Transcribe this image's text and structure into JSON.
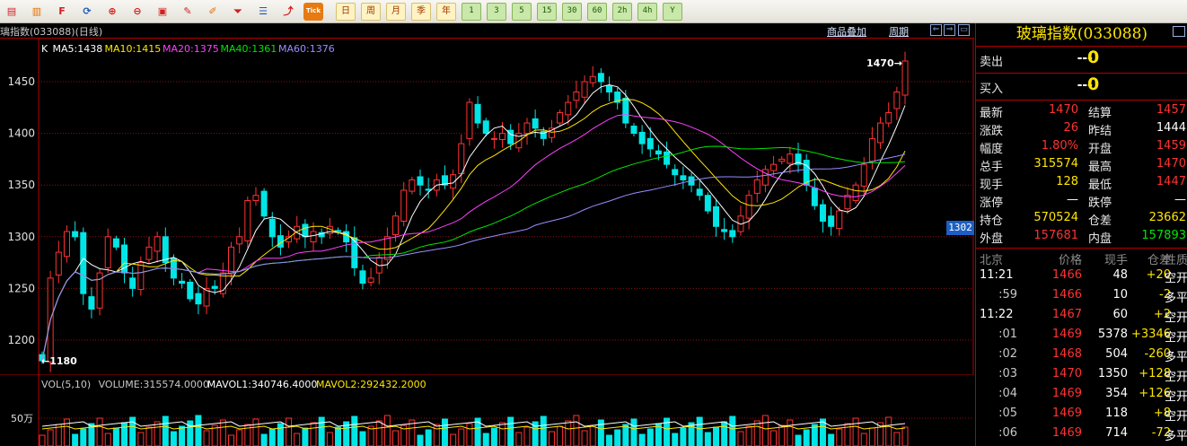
{
  "toolbar": {
    "buttons": [
      {
        "name": "menu-icon",
        "glyph": "▤"
      },
      {
        "name": "save-icon",
        "glyph": "▥"
      },
      {
        "name": "f10-icon",
        "glyph": "F"
      },
      {
        "name": "refresh-icon",
        "glyph": "⟳"
      },
      {
        "name": "zoom-in-icon",
        "glyph": "⊕"
      },
      {
        "name": "zoom-out-icon",
        "glyph": "⊖"
      },
      {
        "name": "window-icon",
        "glyph": "▣"
      },
      {
        "name": "pencil-icon",
        "glyph": "✎"
      },
      {
        "name": "brush-icon",
        "glyph": "✐"
      },
      {
        "name": "filter-icon",
        "glyph": "⏷"
      },
      {
        "name": "list-icon",
        "glyph": "☰"
      },
      {
        "name": "trend-icon",
        "glyph": "⤴"
      },
      {
        "name": "tick-icon",
        "glyph": "Tick"
      }
    ],
    "periods": [
      "日",
      "周",
      "月",
      "季",
      "年"
    ],
    "active_period": "日",
    "minute_buttons": [
      "1",
      "3",
      "5",
      "15",
      "30",
      "60",
      "2h",
      "4h",
      "Y"
    ]
  },
  "chart": {
    "title": "璃指数(033088)(日线)",
    "overlay_label": "商品叠加",
    "period_label": "周期",
    "ma_legend": [
      {
        "label": "K",
        "color": "#ffffff"
      },
      {
        "label": "MA5:1438",
        "color": "#ffffff"
      },
      {
        "label": "MA10:1415",
        "color": "#ffe600"
      },
      {
        "label": "MA20:1375",
        "color": "#ff40ff"
      },
      {
        "label": "MA40:1361",
        "color": "#00e600"
      },
      {
        "label": "MA60:1376",
        "color": "#9a8cff"
      }
    ],
    "y_ticks": [
      "1450",
      "1400",
      "1350",
      "1300",
      "1250",
      "1200"
    ],
    "max_marker": "1470",
    "min_marker": "1180",
    "last_price_tag": "1302",
    "volume_legend": [
      {
        "label": "VOL(5,10)",
        "color": "#c8c8c8"
      },
      {
        "label": "VOLUME:315574.0000",
        "color": "#c8c8c8"
      },
      {
        "label": "MAVOL1:340746.4000",
        "color": "#ffffff"
      },
      {
        "label": "MAVOL2:292432.2000",
        "color": "#ffe600"
      }
    ],
    "volume_tick": "50万"
  },
  "chart_data": {
    "type": "candlestick",
    "ylim": [
      1180,
      1470
    ],
    "closes": [
      1180,
      1260,
      1285,
      1305,
      1300,
      1245,
      1230,
      1265,
      1300,
      1290,
      1265,
      1250,
      1275,
      1290,
      1300,
      1275,
      1260,
      1255,
      1240,
      1235,
      1250,
      1250,
      1265,
      1290,
      1300,
      1335,
      1340,
      1320,
      1300,
      1290,
      1300,
      1310,
      1300,
      1305,
      1300,
      1310,
      1305,
      1295,
      1270,
      1255,
      1260,
      1280,
      1300,
      1320,
      1345,
      1355,
      1350,
      1345,
      1355,
      1350,
      1360,
      1390,
      1430,
      1410,
      1400,
      1395,
      1400,
      1390,
      1400,
      1410,
      1405,
      1395,
      1405,
      1420,
      1430,
      1440,
      1450,
      1455,
      1450,
      1440,
      1430,
      1410,
      1400,
      1390,
      1385,
      1380,
      1370,
      1360,
      1355,
      1350,
      1340,
      1325,
      1310,
      1305,
      1300,
      1320,
      1340,
      1355,
      1365,
      1370,
      1375,
      1380,
      1370,
      1350,
      1330,
      1315,
      1310,
      1325,
      1340,
      1350,
      1370,
      1395,
      1410,
      1420,
      1440,
      1470
    ],
    "ma_values": {
      "MA5": 1438,
      "MA10": 1415,
      "MA20": 1375,
      "MA40": 1361,
      "MA60": 1376
    },
    "volume_ticks": [
      "50万"
    ]
  },
  "quote": {
    "title": "玻璃指数(033088)",
    "sell": {
      "label": "卖出",
      "price": "---",
      "vol": "0"
    },
    "buy": {
      "label": "买入",
      "price": "---",
      "vol": "0"
    },
    "stats": [
      {
        "l1": "最新",
        "v1": "1470",
        "c1": "red",
        "l2": "结算",
        "v2": "1457",
        "c2": "red"
      },
      {
        "l1": "涨跌",
        "v1": "26",
        "c1": "red",
        "l2": "昨结",
        "v2": "1444",
        "c2": "white"
      },
      {
        "l1": "幅度",
        "v1": "1.80%",
        "c1": "red",
        "l2": "开盘",
        "v2": "1459",
        "c2": "red"
      },
      {
        "l1": "总手",
        "v1": "315574",
        "c1": "yellow",
        "l2": "最高",
        "v2": "1470",
        "c2": "red"
      },
      {
        "l1": "现手",
        "v1": "128",
        "c1": "yellow",
        "l2": "最低",
        "v2": "1447",
        "c2": "red"
      },
      {
        "l1": "涨停",
        "v1": "—",
        "c1": "white",
        "l2": "跌停",
        "v2": "—",
        "c2": "white"
      },
      {
        "l1": "持仓",
        "v1": "570524",
        "c1": "yellow",
        "l2": "仓差",
        "v2": "23662",
        "c2": "yellow"
      },
      {
        "l1": "外盘",
        "v1": "157681",
        "c1": "red",
        "l2": "内盘",
        "v2": "157893",
        "c2": "green"
      }
    ],
    "tick_header": {
      "time": "北京",
      "price": "价格",
      "vol": "现手",
      "chg": "仓差",
      "type": "性质"
    },
    "ticks": [
      {
        "time": "11:21",
        "full": true,
        "price": "1466",
        "vol": "48",
        "chg": "+20",
        "chg_color": "yellow",
        "type": "空开"
      },
      {
        "time": ":59",
        "full": false,
        "price": "1466",
        "vol": "10",
        "chg": "-2",
        "chg_color": "yellow",
        "type": "多平"
      },
      {
        "time": "11:22",
        "full": true,
        "price": "1467",
        "vol": "60",
        "chg": "+2",
        "chg_color": "yellow",
        "type": "空开"
      },
      {
        "time": ":01",
        "full": false,
        "price": "1469",
        "vol": "5378",
        "chg": "+3346",
        "chg_color": "yellow",
        "type": "空开"
      },
      {
        "time": ":02",
        "full": false,
        "price": "1468",
        "vol": "504",
        "chg": "-260",
        "chg_color": "yellow",
        "type": "多平"
      },
      {
        "time": ":03",
        "full": false,
        "price": "1470",
        "vol": "1350",
        "chg": "+128",
        "chg_color": "yellow",
        "type": "空开"
      },
      {
        "time": ":04",
        "full": false,
        "price": "1469",
        "vol": "354",
        "chg": "+126",
        "chg_color": "yellow",
        "type": "空开"
      },
      {
        "time": ":05",
        "full": false,
        "price": "1469",
        "vol": "118",
        "chg": "+8",
        "chg_color": "yellow",
        "type": "空开"
      },
      {
        "time": ":06",
        "full": false,
        "price": "1469",
        "vol": "714",
        "chg": "-72",
        "chg_color": "yellow",
        "type": "多平"
      }
    ]
  },
  "colors": {
    "up": "#ff3232",
    "down": "#00e6e6",
    "grid": "#8c1010",
    "border": "#b40000"
  }
}
